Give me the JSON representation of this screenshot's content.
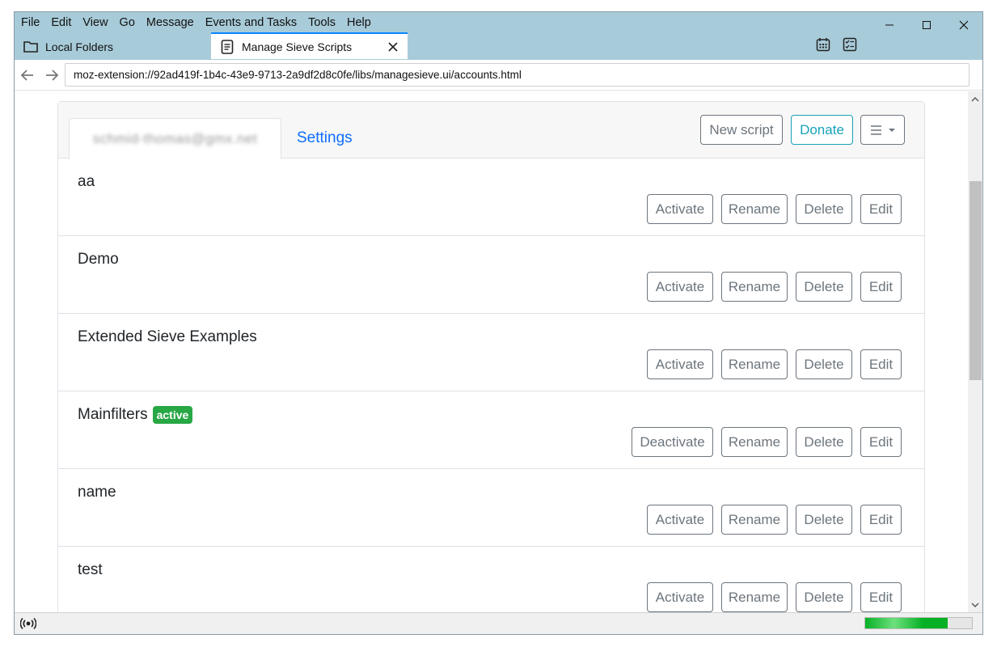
{
  "menu": [
    "File",
    "Edit",
    "View",
    "Go",
    "Message",
    "Events and Tasks",
    "Tools",
    "Help"
  ],
  "window_controls": {
    "minimize": "—",
    "maximize": "☐",
    "close": "✕"
  },
  "tabs": [
    {
      "label": "Local Folders",
      "icon": "folder-icon"
    },
    {
      "label": "Manage Sieve Scripts",
      "icon": "document-icon",
      "close": "✕"
    }
  ],
  "toolbar_icons": [
    "calendar-icon",
    "tasks-icon"
  ],
  "nav": {
    "back": "←",
    "forward": "→",
    "url": "moz-extension://92ad419f-1b4c-43e9-9713-2a9df2d8c0fe/libs/managesieve.ui/accounts.html"
  },
  "account": {
    "name_blurred": "schmid-thomas@gmx.net",
    "settings_label": "Settings",
    "new_script_label": "New script",
    "donate_label": "Donate",
    "menu_label": "☰ ▾"
  },
  "scripts": [
    {
      "name": "aa",
      "active": false,
      "toggle_label": "Activate",
      "rename": "Rename",
      "delete": "Delete",
      "edit": "Edit"
    },
    {
      "name": "Demo",
      "active": false,
      "toggle_label": "Activate",
      "rename": "Rename",
      "delete": "Delete",
      "edit": "Edit"
    },
    {
      "name": "Extended Sieve Examples",
      "active": false,
      "toggle_label": "Activate",
      "rename": "Rename",
      "delete": "Delete",
      "edit": "Edit"
    },
    {
      "name": "Mainfilters",
      "active": true,
      "badge": "active",
      "toggle_label": "Deactivate",
      "rename": "Rename",
      "delete": "Delete",
      "edit": "Edit"
    },
    {
      "name": "name",
      "active": false,
      "toggle_label": "Activate",
      "rename": "Rename",
      "delete": "Delete",
      "edit": "Edit"
    },
    {
      "name": "test",
      "active": false,
      "toggle_label": "Activate",
      "rename": "Rename",
      "delete": "Delete",
      "edit": "Edit"
    }
  ],
  "status": {
    "icon": "online-status-icon",
    "progress_fraction": 0.77
  },
  "colors": {
    "titlebar": "#a8cbd9",
    "link": "#0d6efd",
    "info": "#17a2b8",
    "badge": "#28a745",
    "secondary": "#6c757d"
  }
}
